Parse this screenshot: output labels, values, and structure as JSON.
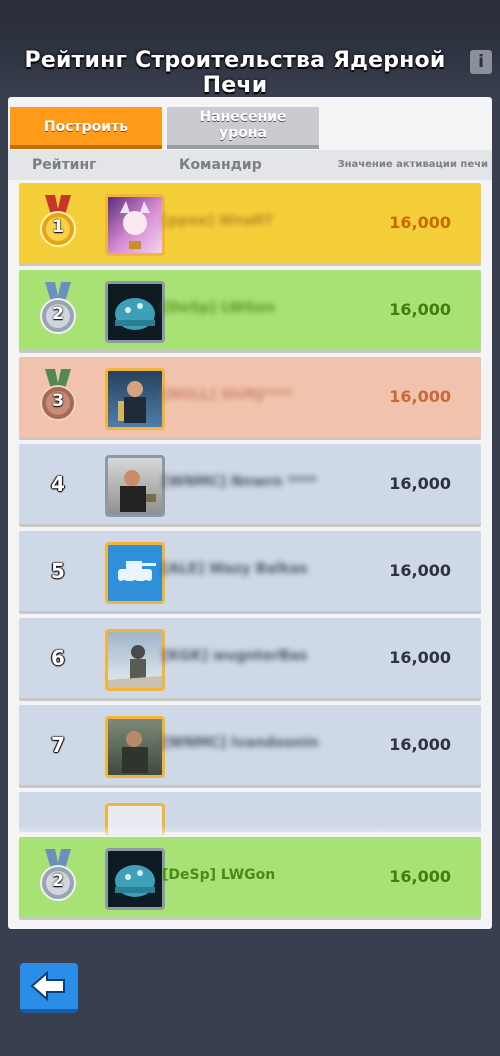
{
  "header": {
    "title": "Рейтинг Строительства Ядерной Печи",
    "info_icon": "info-icon"
  },
  "tabs": [
    {
      "label": "Построить",
      "active": true
    },
    {
      "label": "Нанесение урона",
      "active": false
    }
  ],
  "columns": {
    "rank": "Рейтинг",
    "commander": "Командир",
    "value": "Значение активации печи"
  },
  "rows": [
    {
      "rank": "1",
      "name": "[ppee] WnaRT",
      "value": "16,000"
    },
    {
      "rank": "2",
      "name": "[DeSp] LWGon",
      "value": "16,000"
    },
    {
      "rank": "3",
      "name": "[NULL] ShiftJ****",
      "value": "16,000"
    },
    {
      "rank": "4",
      "name": "[WNMC] Nnwrn ****",
      "value": "16,000"
    },
    {
      "rank": "5",
      "name": "[ALE] Wazy Balkas",
      "value": "16,000"
    },
    {
      "rank": "6",
      "name": "[KGK] wugnterBas",
      "value": "16,000"
    },
    {
      "rank": "7",
      "name": "[WNMC] Ivandoonin",
      "value": "16,000"
    }
  ],
  "my_row": {
    "rank": "2",
    "name": "[DeSp] LWGon",
    "value": "16,000"
  },
  "colors": {
    "gold_row": "#f5cf3a",
    "silver_row": "#a8e274",
    "bronze_row": "#f2c3ac",
    "default_row": "#cfd8e6",
    "accent_orange": "#ff9a1a",
    "value_green": "#3f7e12"
  },
  "back_button_icon": "arrow-left-icon"
}
